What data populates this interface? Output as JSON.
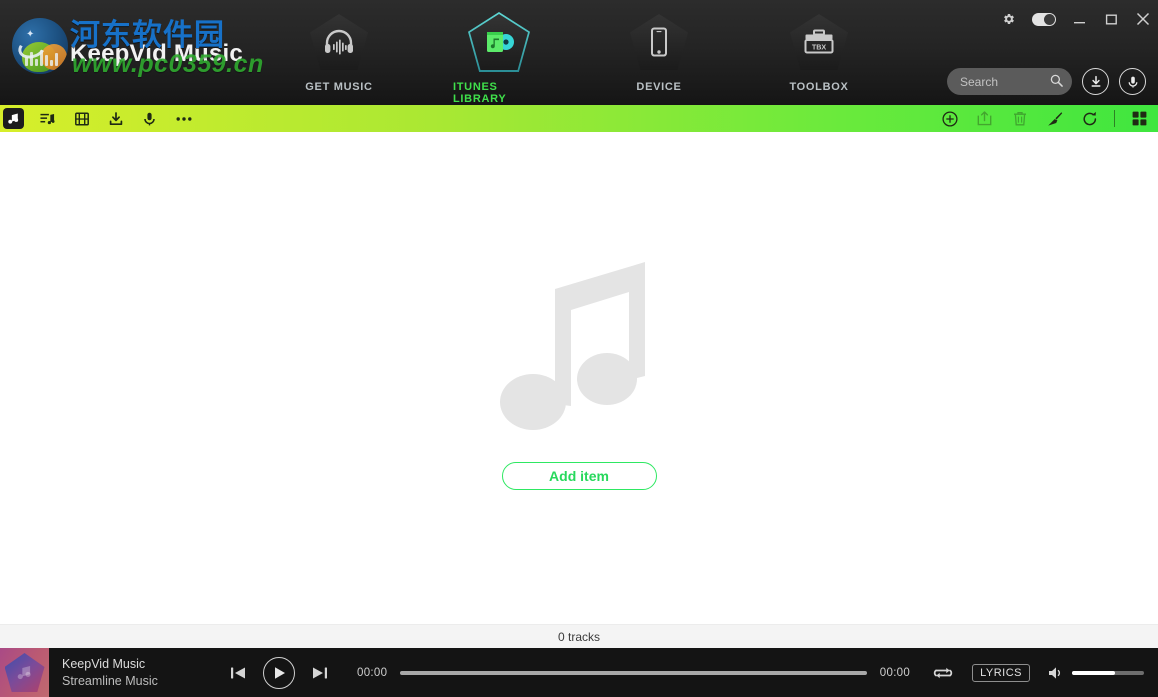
{
  "app": {
    "brand_cn": "河东软件园",
    "brand_en": "KeepVid Music",
    "brand_url": "www.pc0359.cn"
  },
  "window_controls": {
    "settings": "settings-gear",
    "toggle": "mode-toggle",
    "minimize": "minimize",
    "maximize": "maximize",
    "close": "close"
  },
  "nav": {
    "items": [
      {
        "label": "GET MUSIC",
        "icon": "headphones-icon",
        "active": false
      },
      {
        "label": "ITUNES LIBRARY",
        "icon": "itunes-library-icon",
        "active": true
      },
      {
        "label": "DEVICE",
        "icon": "phone-icon",
        "active": false
      },
      {
        "label": "TOOLBOX",
        "icon": "toolbox-icon",
        "active": false,
        "icon_text": "TBX"
      }
    ]
  },
  "search": {
    "value": "",
    "placeholder": "Search"
  },
  "header_buttons": {
    "download": "download-circle-button",
    "record": "microphone-circle-button"
  },
  "toolbar": {
    "left": [
      {
        "name": "music-note-icon",
        "label": "Music",
        "active": true
      },
      {
        "name": "playlist-icon",
        "label": "Playlist",
        "active": false
      },
      {
        "name": "video-icon",
        "label": "Video",
        "active": false
      },
      {
        "name": "download-icon",
        "label": "Downloaded",
        "active": false
      },
      {
        "name": "microphone-icon",
        "label": "Recorded",
        "active": false
      },
      {
        "name": "more-icon",
        "label": "More",
        "active": false
      }
    ],
    "right": [
      {
        "name": "add-circle-icon",
        "label": "Add",
        "dim": false
      },
      {
        "name": "export-icon",
        "label": "Export",
        "dim": true
      },
      {
        "name": "trash-icon",
        "label": "Delete",
        "dim": true
      },
      {
        "name": "broom-icon",
        "label": "Clean",
        "dim": false
      },
      {
        "name": "refresh-icon",
        "label": "Refresh",
        "dim": false
      },
      {
        "name": "grid-view-icon",
        "label": "Grid view",
        "dim": false
      }
    ]
  },
  "stage": {
    "empty_icon": "music-note-large-icon",
    "add_item_label": "Add item"
  },
  "status": {
    "tracks": "0 tracks"
  },
  "player": {
    "title": "KeepVid Music",
    "subtitle": "Streamline Music",
    "time_elapsed": "00:00",
    "time_total": "00:00",
    "progress_percent": 0,
    "volume_percent": 60,
    "lyrics_label": "LYRICS",
    "controls": {
      "previous": "previous-icon",
      "play": "play-icon",
      "next": "next-icon",
      "repeat": "repeat-icon",
      "volume": "volume-icon"
    }
  },
  "colors": {
    "toolbar_start": "#d7ee2a",
    "toolbar_end": "#3fe63f",
    "accent_green": "#27d85c",
    "active_nav": "#3fe04b",
    "header_bg": "#242424",
    "player_bg": "#141414",
    "status_bg": "#f4f4f4"
  }
}
